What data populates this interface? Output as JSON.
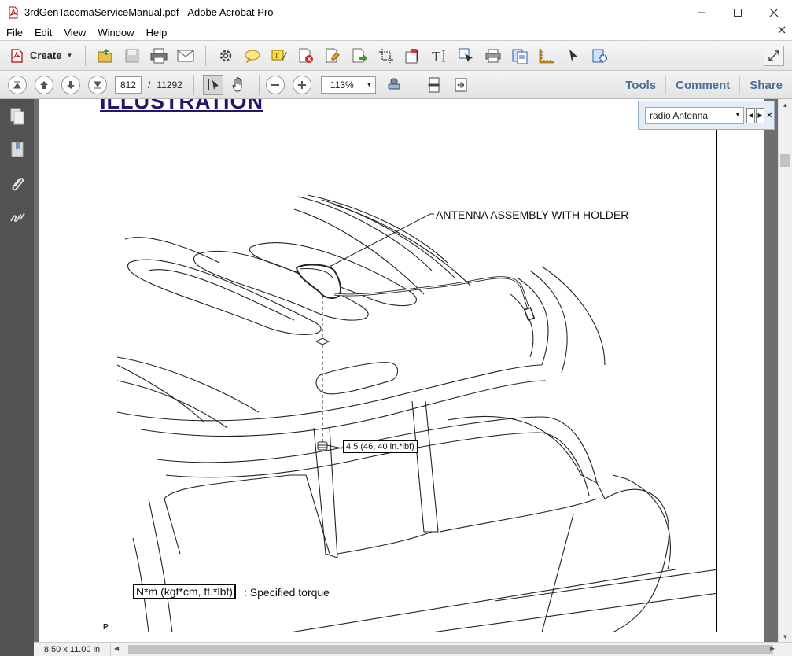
{
  "window": {
    "title": "3rdGenTacomaServiceManual.pdf - Adobe Acrobat Pro"
  },
  "menu": [
    "File",
    "Edit",
    "View",
    "Window",
    "Help"
  ],
  "toolbar": {
    "create_label": "Create"
  },
  "navigation": {
    "current_page": "812",
    "page_separator": "/",
    "total_pages": "11292",
    "zoom": "113%"
  },
  "panels": {
    "tools": "Tools",
    "comment": "Comment",
    "share": "Share"
  },
  "find": {
    "query": "radio Antenna"
  },
  "document": {
    "heading": "ILLUSTRATION",
    "callout_antenna": "ANTENNA ASSEMBLY WITH HOLDER",
    "torque_value": "4.5 (46, 40 in.*lbf)",
    "torque_units": "N*m (kgf*cm, ft.*lbf)",
    "torque_legend": ": Specified torque",
    "page_mark": "P"
  },
  "status": {
    "page_size": "8.50 x 11.00 in"
  },
  "colors": {
    "panel_tab": "#4b6f99",
    "heading": "#24156e",
    "nav_pane": "#525252",
    "doc_bg": "#6e6e6e"
  }
}
